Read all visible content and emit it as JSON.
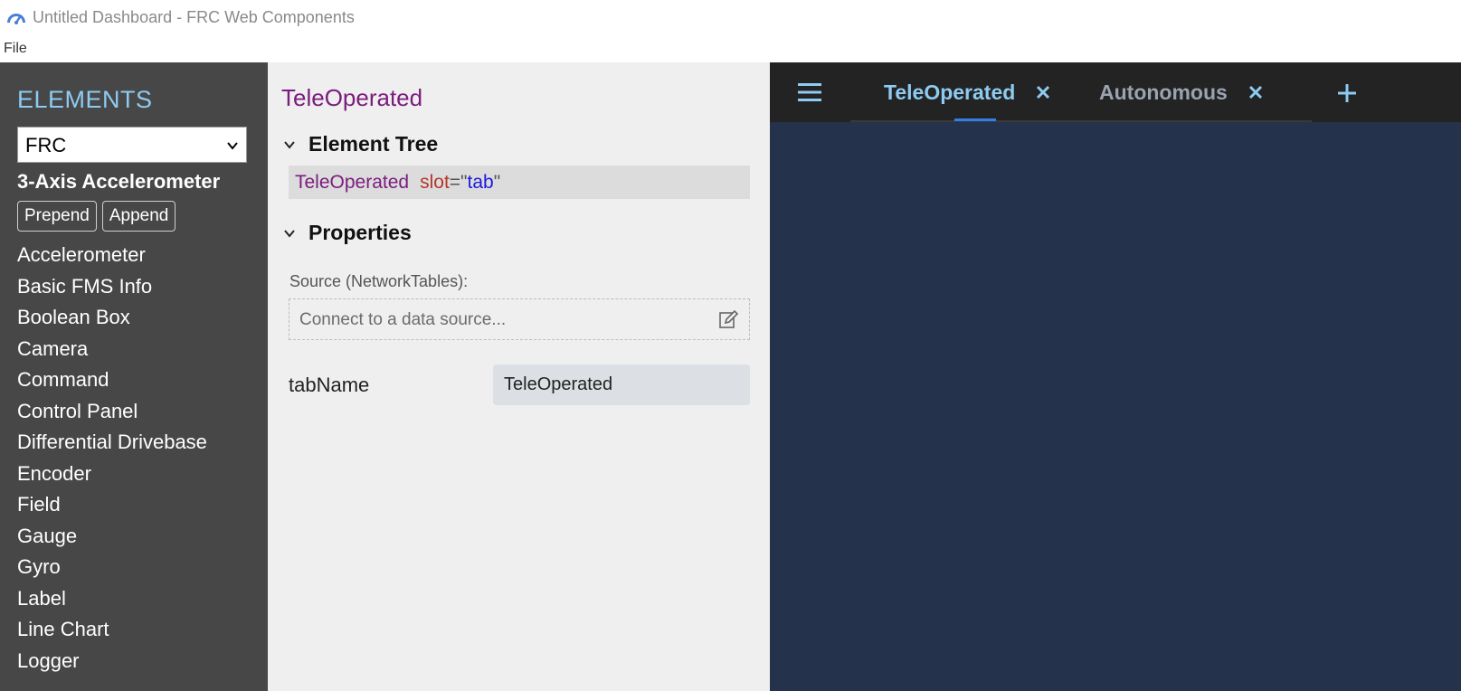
{
  "window": {
    "title": "Untitled Dashboard - FRC Web Components",
    "icon": "speedometer-icon"
  },
  "menubar": {
    "items": [
      "File"
    ]
  },
  "sidebar": {
    "title": "ELEMENTS",
    "source_select": {
      "value": "FRC"
    },
    "selected_element": "3-Axis Accelerometer",
    "buttons": {
      "prepend": "Prepend",
      "append": "Append"
    },
    "items": [
      "Accelerometer",
      "Basic FMS Info",
      "Boolean Box",
      "Camera",
      "Command",
      "Control Panel",
      "Differential Drivebase",
      "Encoder",
      "Field",
      "Gauge",
      "Gyro",
      "Label",
      "Line Chart",
      "Logger"
    ]
  },
  "properties_panel": {
    "title": "TeleOperated",
    "element_tree": {
      "heading": "Element Tree",
      "node": {
        "tag": "TeleOperated",
        "attr_name": "slot",
        "attr_eq": "=\"",
        "attr_value": "tab",
        "attr_close": "\""
      }
    },
    "properties": {
      "heading": "Properties",
      "source_label": "Source (NetworkTables):",
      "source_placeholder": "Connect to a data source...",
      "fields": [
        {
          "name": "tabName",
          "value": "TeleOperated"
        }
      ]
    }
  },
  "dashboard": {
    "tabs": [
      {
        "label": "TeleOperated",
        "active": true
      },
      {
        "label": "Autonomous",
        "active": false
      }
    ],
    "colors": {
      "tab_text": "#8ecbf2",
      "inactive_tab_text": "#9aa3b0",
      "active_indicator": "#2f7fe9",
      "canvas": "#24324b",
      "tabbar": "#232323"
    }
  }
}
